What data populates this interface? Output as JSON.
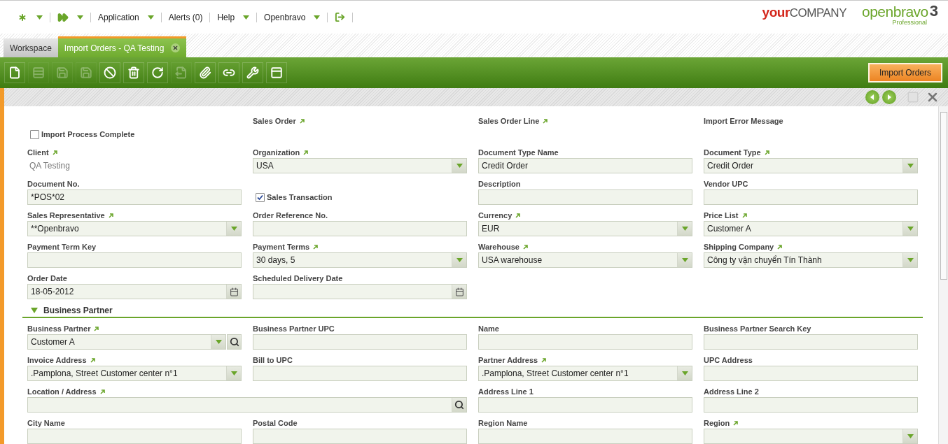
{
  "nav": {
    "menus": [
      {
        "label": "Application",
        "dropdown": true
      },
      {
        "label": "Alerts (0)",
        "dropdown": false
      },
      {
        "label": "Help",
        "dropdown": true
      },
      {
        "label": "Openbravo",
        "dropdown": true
      }
    ]
  },
  "company_logo": {
    "strong": "your",
    "rest": "COMPANY"
  },
  "product_logo": {
    "name": "openbravo",
    "version": "3",
    "edition": "Professional"
  },
  "tabs": [
    {
      "label": "Workspace",
      "selected": false,
      "closable": false
    },
    {
      "label": "Import Orders - QA Testing",
      "selected": true,
      "closable": true
    }
  ],
  "toolbar": {
    "buttons": [
      {
        "kind": "new",
        "disabled": false
      },
      {
        "kind": "newrow",
        "disabled": true
      },
      {
        "kind": "save",
        "disabled": true
      },
      {
        "kind": "saveclose",
        "disabled": true
      },
      {
        "kind": "undo",
        "disabled": false
      },
      {
        "kind": "delete",
        "disabled": false
      },
      {
        "kind": "refresh",
        "disabled": false
      },
      {
        "kind": "export",
        "disabled": true
      },
      {
        "kind": "attach",
        "disabled": false
      },
      {
        "kind": "link",
        "disabled": false
      },
      {
        "kind": "tools",
        "disabled": false
      },
      {
        "kind": "layout",
        "disabled": false
      }
    ],
    "action": "Import Orders"
  },
  "form": {
    "fields": [
      {
        "kind": "checkbox",
        "label": "Import Process Complete",
        "checked": false
      },
      {
        "kind": "heading",
        "label": "Sales Order",
        "link": true
      },
      {
        "kind": "heading",
        "label": "Sales Order Line",
        "link": true
      },
      {
        "kind": "heading",
        "label": "Import Error Message",
        "link": false
      },
      {
        "kind": "readonly",
        "label": "Client",
        "link": true,
        "value": "QA Testing"
      },
      {
        "kind": "select",
        "label": "Organization",
        "link": true,
        "value": "USA"
      },
      {
        "kind": "text",
        "label": "Document Type Name",
        "link": false,
        "value": "Credit Order"
      },
      {
        "kind": "select",
        "label": "Document Type",
        "link": true,
        "value": "Credit Order"
      },
      {
        "kind": "text",
        "label": "Document No.",
        "link": false,
        "value": "*POS*02"
      },
      {
        "kind": "checkbox",
        "label": "Sales Transaction",
        "checked": true
      },
      {
        "kind": "text",
        "label": "Description",
        "link": false
      },
      {
        "kind": "text",
        "label": "Vendor UPC",
        "link": false
      },
      {
        "kind": "select",
        "label": "Sales Representative",
        "link": true,
        "value": "**Openbravo"
      },
      {
        "kind": "text",
        "label": "Order Reference No.",
        "link": false
      },
      {
        "kind": "select",
        "label": "Currency",
        "link": true,
        "value": "EUR"
      },
      {
        "kind": "select",
        "label": "Price List",
        "link": true,
        "value": "Customer A"
      },
      {
        "kind": "text",
        "label": "Payment Term Key",
        "link": false
      },
      {
        "kind": "select",
        "label": "Payment Terms",
        "link": true,
        "value": "30 days, 5"
      },
      {
        "kind": "select",
        "label": "Warehouse",
        "link": true,
        "value": "USA warehouse"
      },
      {
        "kind": "select",
        "label": "Shipping Company",
        "link": true,
        "value": "Công ty vận chuyển Tín Thành"
      },
      {
        "kind": "date",
        "label": "Order Date",
        "link": false,
        "value": "18-05-2012"
      },
      {
        "kind": "date",
        "label": "Scheduled Delivery Date",
        "link": false
      }
    ],
    "sections": [
      {
        "title": "Business Partner",
        "expanded": true,
        "fields": [
          {
            "kind": "selectsearch",
            "label": "Business Partner",
            "link": true,
            "value": "Customer A"
          },
          {
            "kind": "text",
            "label": "Business Partner UPC",
            "link": false
          },
          {
            "kind": "text",
            "label": "Name",
            "link": false
          },
          {
            "kind": "text",
            "label": "Business Partner Search Key",
            "link": false
          },
          {
            "kind": "select",
            "label": "Invoice Address",
            "link": true,
            "value": ".Pamplona, Street Customer center n°1"
          },
          {
            "kind": "text",
            "label": "Bill to UPC",
            "link": false
          },
          {
            "kind": "select",
            "label": "Partner Address",
            "link": true,
            "value": ".Pamplona, Street Customer center n°1"
          },
          {
            "kind": "text",
            "label": "UPC Address",
            "link": false
          },
          {
            "kind": "search",
            "label": "Location / Address",
            "link": true,
            "wide": true
          },
          {
            "kind": "text",
            "label": "Address Line 1",
            "link": false
          },
          {
            "kind": "text",
            "label": "Address Line 2",
            "link": false
          },
          {
            "kind": "text",
            "label": "City Name",
            "link": false
          },
          {
            "kind": "text",
            "label": "Postal Code",
            "link": false
          },
          {
            "kind": "text",
            "label": "Region Name",
            "link": false
          },
          {
            "kind": "select",
            "label": "Region",
            "link": true
          }
        ]
      }
    ]
  }
}
